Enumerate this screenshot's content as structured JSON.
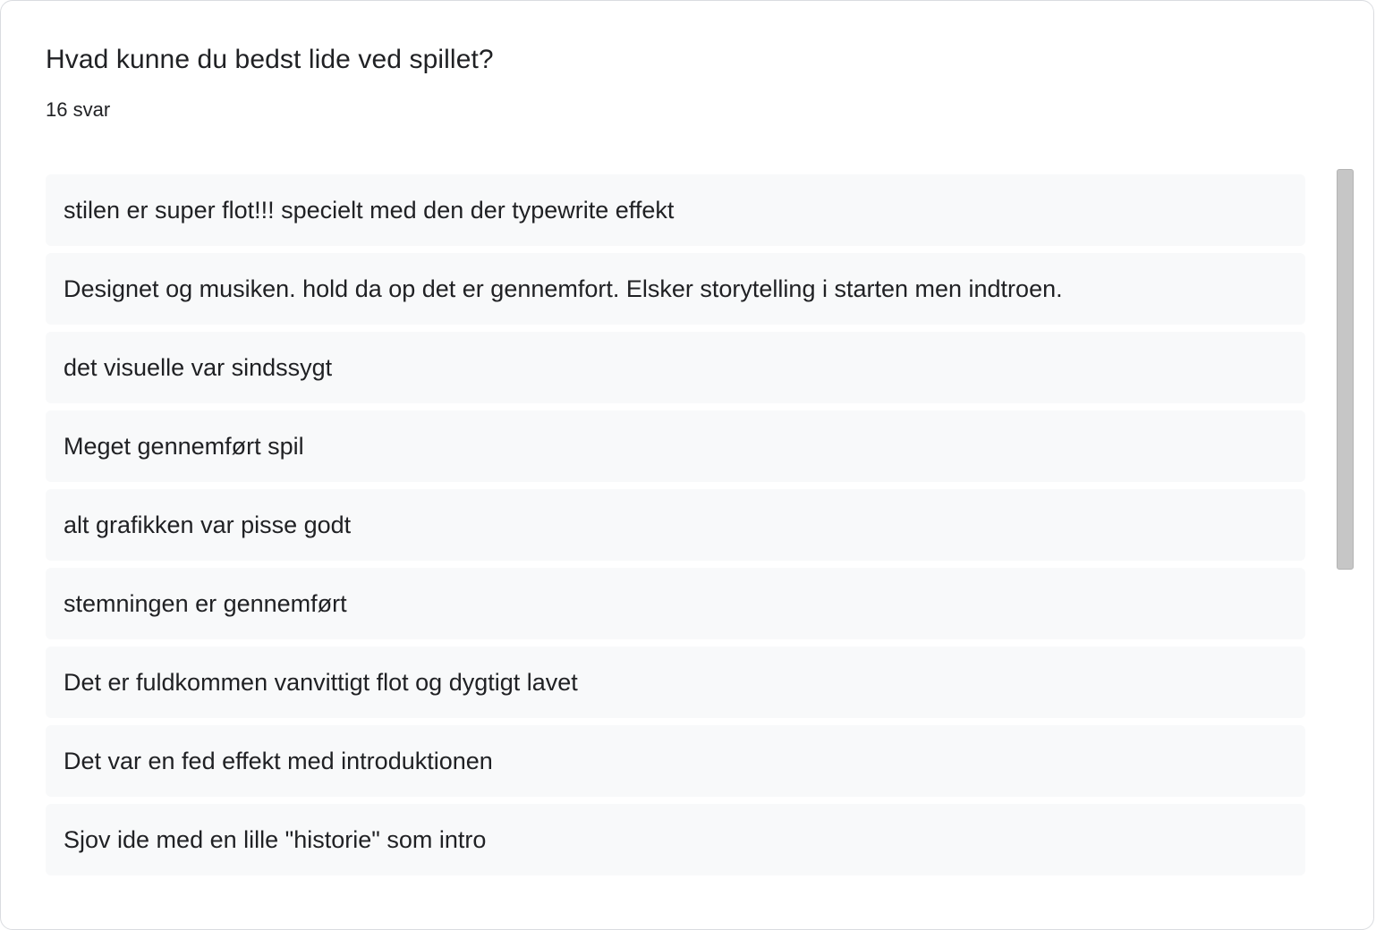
{
  "question": {
    "title": "Hvad kunne du bedst lide ved spillet?",
    "response_count": "16 svar"
  },
  "responses": [
    "stilen er super flot!!! specielt med den der typewrite effekt",
    "Designet og musiken. hold da op det er gennemfort. Elsker storytelling i starten men indtroen.",
    "det visuelle var sindssygt",
    "Meget gennemført spil",
    "alt grafikken var pisse godt",
    "stemningen er gennemført",
    "Det er fuldkommen vanvittigt flot og dygtigt lavet",
    "Det var en fed effekt med introduktionen",
    "Sjov ide med en lille \"historie\" som intro"
  ],
  "scrollbar": {
    "thumb_visible_fraction": 0.56
  }
}
